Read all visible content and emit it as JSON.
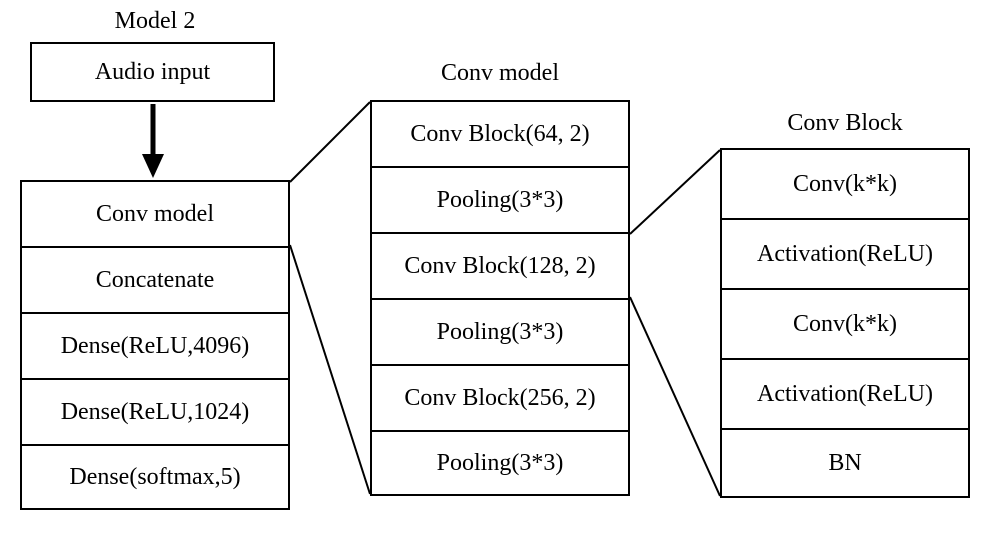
{
  "titles": {
    "model2": "Model 2",
    "conv_model": "Conv  model",
    "conv_block": "Conv  Block"
  },
  "audio_input": "Audio input",
  "pipeline": {
    "conv_model": "Conv model",
    "concatenate": "Concatenate",
    "dense1": "Dense(ReLU,4096)",
    "dense2": "Dense(ReLU,1024)",
    "dense3": "Dense(softmax,5)"
  },
  "conv_model_detail": {
    "block1": "Conv Block(64, 2)",
    "pool1": "Pooling(3*3)",
    "block2": "Conv Block(128, 2)",
    "pool2": "Pooling(3*3)",
    "block3": "Conv Block(256, 2)",
    "pool3": "Pooling(3*3)"
  },
  "conv_block_detail": {
    "conv1": "Conv(k*k)",
    "act1": "Activation(ReLU)",
    "conv2": "Conv(k*k)",
    "act2": "Activation(ReLU)",
    "bn": "BN"
  },
  "chart_data": {
    "type": "diagram",
    "description": "Neural network architecture (Model 2) showing audio input flowing into a Conv model followed by Concatenate and three Dense layers. Conv model expands into 3 Conv Blocks with pooling. Conv Block expands into Conv, Activation, Conv, Activation, BN.",
    "model2_pipeline": [
      "Audio input",
      "Conv model",
      "Concatenate",
      "Dense(ReLU,4096)",
      "Dense(ReLU,1024)",
      "Dense(softmax,5)"
    ],
    "conv_model_layers": [
      "Conv Block(64, 2)",
      "Pooling(3*3)",
      "Conv Block(128, 2)",
      "Pooling(3*3)",
      "Conv Block(256, 2)",
      "Pooling(3*3)"
    ],
    "conv_block_layers": [
      "Conv(k*k)",
      "Activation(ReLU)",
      "Conv(k*k)",
      "Activation(ReLU)",
      "BN"
    ]
  }
}
